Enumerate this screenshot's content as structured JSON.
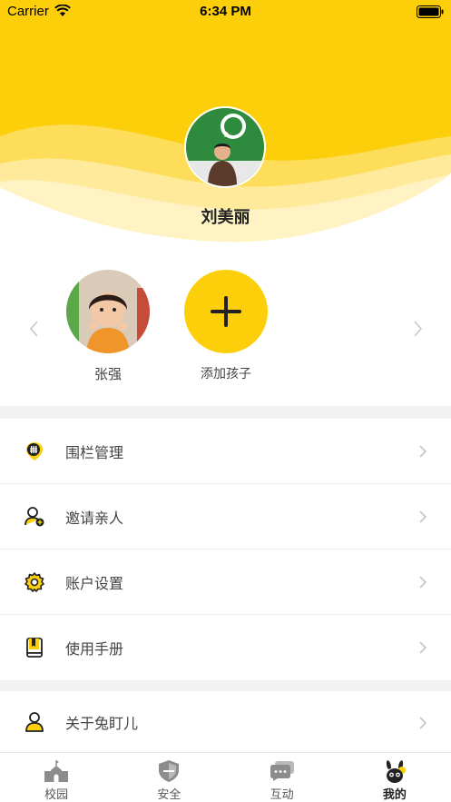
{
  "status_bar": {
    "carrier": "Carrier",
    "time": "6:34 PM"
  },
  "profile": {
    "name": "刘美丽"
  },
  "children": [
    {
      "name": "张强"
    },
    {
      "name": "添加孩子"
    }
  ],
  "menu_group_1": [
    {
      "label": "围栏管理",
      "icon": "fence-pin-icon"
    },
    {
      "label": "邀请亲人",
      "icon": "invite-user-icon"
    },
    {
      "label": "账户设置",
      "icon": "gear-icon"
    },
    {
      "label": "使用手册",
      "icon": "manual-book-icon"
    }
  ],
  "menu_group_2": [
    {
      "label": "关于兔盯儿",
      "icon": "about-user-icon"
    }
  ],
  "tabbar": [
    {
      "label": "校园",
      "icon": "school-icon"
    },
    {
      "label": "安全",
      "icon": "shield-icon"
    },
    {
      "label": "互动",
      "icon": "chat-icon"
    },
    {
      "label": "我的",
      "icon": "rabbit-profile-icon"
    }
  ],
  "colors": {
    "accent": "#fccf0a",
    "text": "#444444",
    "tab_inactive": "#8c8c8c"
  }
}
